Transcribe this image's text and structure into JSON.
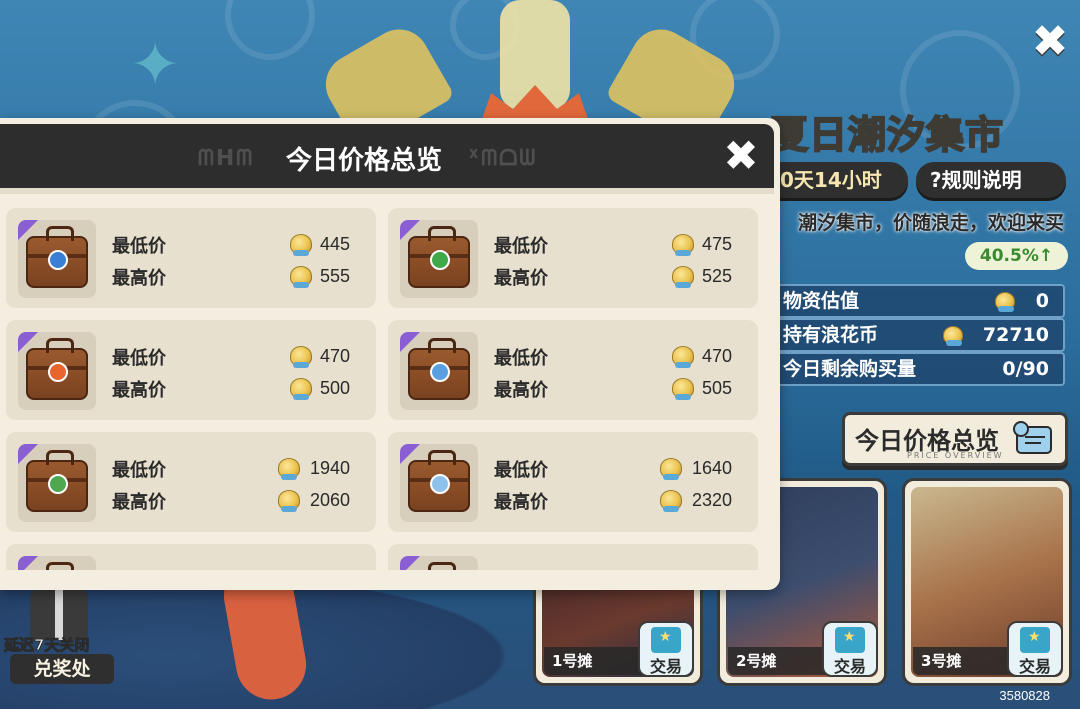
{
  "event": {
    "title": "夏日潮汐集市",
    "time_left": "0天14小时",
    "rules_label": "?规则说明",
    "slogan": "潮汐集市，价随浪走，欢迎来买",
    "change_pct": "40.5%",
    "change_arrow": "↑"
  },
  "stats": [
    {
      "label": "物资估值",
      "value": "0"
    },
    {
      "label": "持有浪花币",
      "value": "72710"
    },
    {
      "label": "今日剩余购买量",
      "value": "0/90"
    }
  ],
  "overview_button": {
    "label": "今日价格总览",
    "sub": "PRICE OVERVIEW"
  },
  "stalls": [
    {
      "name": "1号摊",
      "trade": "交易"
    },
    {
      "name": "2号摊",
      "trade": "交易"
    },
    {
      "name": "3号摊",
      "trade": "交易"
    }
  ],
  "claim": {
    "delay": "延迟7天关闭",
    "label": "兑奖处"
  },
  "uid": "3580828",
  "modal": {
    "title": "今日价格总览",
    "deco_left": "ᗰᕼᗰ",
    "deco_right": "ᕁᗰᗝᗯ",
    "min_label": "最低价",
    "max_label": "最高价",
    "items": [
      {
        "badge_color": "#3a7fd6",
        "min": "445",
        "max": "555"
      },
      {
        "badge_color": "#3fa84a",
        "min": "475",
        "max": "525"
      },
      {
        "badge_color": "#e8662e",
        "min": "470",
        "max": "500"
      },
      {
        "badge_color": "#5aa0e0",
        "min": "470",
        "max": "505"
      },
      {
        "badge_color": "#4fa84f",
        "min": "1940",
        "max": "2060"
      },
      {
        "badge_color": "#8fc2ea",
        "min": "1640",
        "max": "2320"
      },
      {
        "badge_color": "#c08a3a",
        "min": "",
        "max": ""
      },
      {
        "badge_color": "#c08a3a",
        "min": "",
        "max": ""
      }
    ]
  },
  "colors": {
    "modal_bg": "#f3eedf",
    "header_bg": "#2d2d2d",
    "card_bg": "#e7e0ce",
    "rarity_purple": "#8a5fd4",
    "up_green": "#3a8a2f"
  }
}
